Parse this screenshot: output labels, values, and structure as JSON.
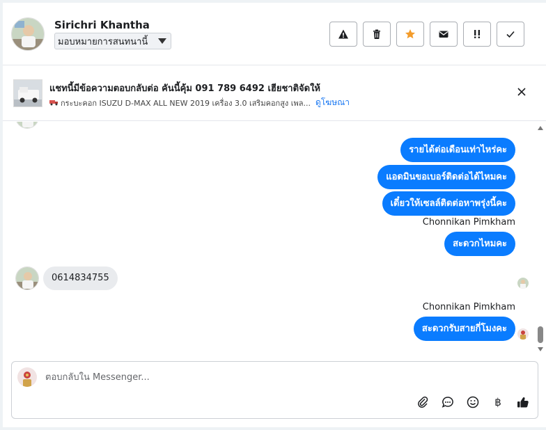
{
  "header": {
    "contact_name": "Sirichri Khantha",
    "assign_label": "มอบหมายการสนทนานี้",
    "actions": [
      {
        "icon": "warning-icon"
      },
      {
        "icon": "trash-icon"
      },
      {
        "icon": "star-icon",
        "color": "#f39c2b"
      },
      {
        "icon": "envelope-icon"
      },
      {
        "icon": "follow-up-icon",
        "label": "!!"
      },
      {
        "icon": "check-icon"
      }
    ]
  },
  "ad": {
    "title": "แชทนี้มีข้อความตอบกลับต่อ คันนี้คุ้ม 091 789 6492 เฮียชาติจัดให้",
    "subtitle": "กระบะคอก ISUZU D-MAX ALL NEW 2019 เครื่อง 3.0 เสริมคอกสูง เพล...",
    "link": "ดูโฆษณา"
  },
  "messages": {
    "out1": "รายได้ต่อเดือนเท่าไหร่คะ",
    "out2": "แอดมินขอเบอร์ติดต่อได้ไหมคะ",
    "out3": "เดี๋ยวให้เซลล์ติดต่อหาพรุ่งนี้คะ",
    "sender1": "Chonnikan Pimkham",
    "out4": "สะดวกไหมคะ",
    "in1": "0614834755",
    "sender2": "Chonnikan Pimkham",
    "out5": "สะดวกรับสายกี่โมงคะ"
  },
  "composer": {
    "placeholder": "ตอบกลับใน Messenger...",
    "baht_symbol": "฿"
  },
  "colors": {
    "accent": "#0a7cff",
    "link": "#1877f2",
    "star": "#f39c2b"
  }
}
